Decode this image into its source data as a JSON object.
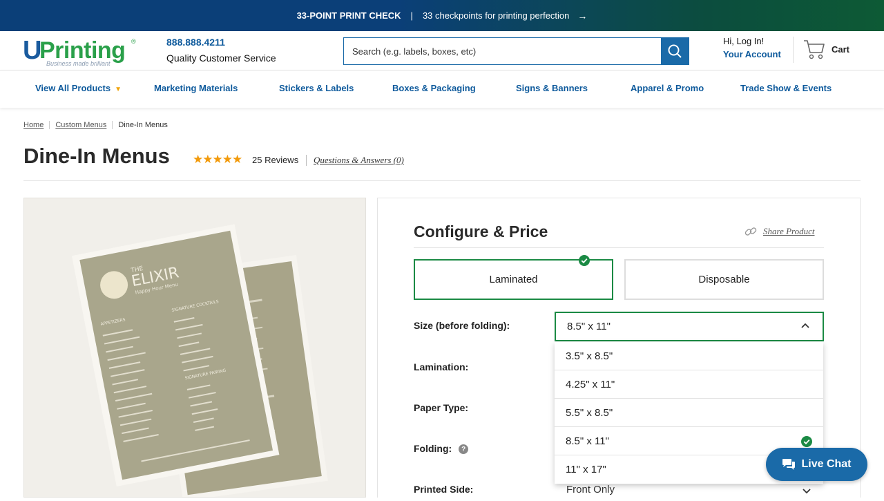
{
  "banner": {
    "headline": "33-POINT PRINT CHECK",
    "separator": "|",
    "subtext": "33 checkpoints for printing perfection",
    "arrow": "→"
  },
  "header": {
    "logo_u": "U",
    "logo_printing": "Printing",
    "logo_reg": "®",
    "logo_tagline": "Business made brilliant",
    "phone": "888.888.4211",
    "service": "Quality Customer Service",
    "search_placeholder": "Search (e.g. labels, boxes, etc)",
    "greeting": "Hi, Log In!",
    "account": "Your Account",
    "cart": "Cart"
  },
  "nav": {
    "items": [
      {
        "label": "View All Products"
      },
      {
        "label": "Marketing Materials"
      },
      {
        "label": "Stickers & Labels"
      },
      {
        "label": "Boxes & Packaging"
      },
      {
        "label": "Signs & Banners"
      },
      {
        "label": "Apparel & Promo"
      },
      {
        "label": "Trade Show & Events"
      }
    ]
  },
  "breadcrumb": [
    "Home",
    "Custom Menus",
    "Dine-In Menus"
  ],
  "product": {
    "title": "Dine-In Menus",
    "rating": "★★★★★",
    "reviews": "25 Reviews",
    "qa": "Questions & Answers (0)"
  },
  "menu_image": {
    "brand_small": "THE",
    "brand": "ELIXIR",
    "brand_sub": "Happy Hour Menu",
    "col1_head": "APPETIZERS",
    "col2_head": "SIGNATURE COCKTAILS",
    "col2_head2": "SIGNATURE PAIRING"
  },
  "configure": {
    "title": "Configure & Price",
    "share": "Share Product",
    "options": [
      {
        "label": "Laminated",
        "selected": true
      },
      {
        "label": "Disposable",
        "selected": false
      }
    ],
    "fields": {
      "size_label": "Size (before folding):",
      "size_value": "8.5\" x 11\"",
      "lamination_label": "Lamination:",
      "paper_label": "Paper Type:",
      "folding_label": "Folding:",
      "folding_help": "?",
      "printed_label": "Printed Side:",
      "printed_value": "Front Only"
    },
    "size_options": [
      {
        "label": "3.5\" x 8.5\"",
        "selected": false
      },
      {
        "label": "4.25\" x 11\"",
        "selected": false
      },
      {
        "label": "5.5\" x 8.5\"",
        "selected": false
      },
      {
        "label": "8.5\" x 11\"",
        "selected": true
      },
      {
        "label": "11\" x 17\"",
        "selected": false
      }
    ]
  },
  "chat": {
    "label": "Live Chat"
  },
  "colors": {
    "brand_blue": "#1a6aa8",
    "brand_green": "#1b8a44",
    "star": "#f29a0b"
  }
}
